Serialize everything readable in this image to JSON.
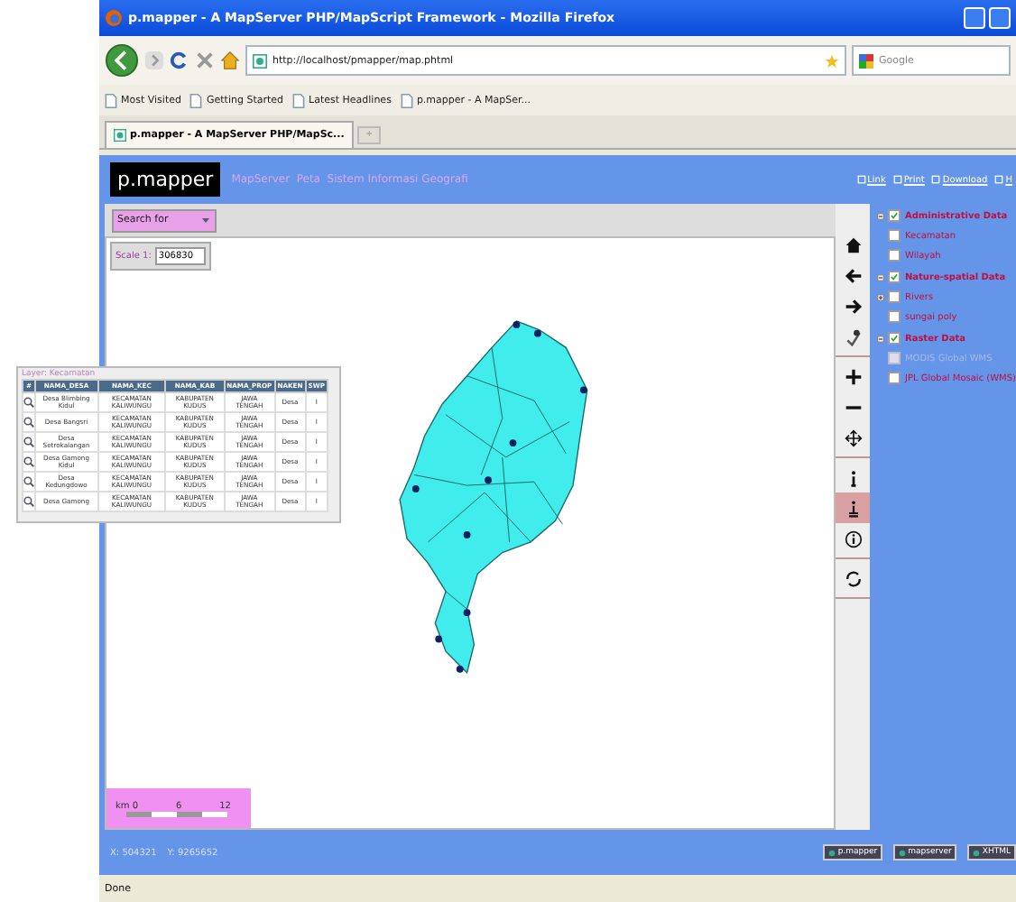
{
  "window": {
    "title": "p.mapper - A MapServer PHP/MapScript Framework - Mozilla Firefox"
  },
  "navigation": {
    "url": "http://localhost/pmapper/map.phtml",
    "search_placeholder": "Google"
  },
  "bookmarks": [
    "Most Visited",
    "Getting Started",
    "Latest Headlines",
    "p.mapper - A MapSer..."
  ],
  "tabs": [
    {
      "label": "p.mapper - A MapServer PHP/MapSc...",
      "selected": true
    }
  ],
  "new_tab": "+",
  "page": {
    "logo": "p.mapper",
    "heading": "MapServer  Peta  Sistem Informasi Geografi",
    "links": [
      "Link",
      "Print",
      "Download",
      "H"
    ],
    "search": {
      "value": "Search for"
    },
    "scale": {
      "label": "Scale 1:",
      "value": "306830"
    },
    "scale_bar": {
      "unit": "km 0",
      "ticks": [
        "6",
        "12"
      ]
    },
    "toolbar": [
      {
        "tools": [
          {
            "kind": "home",
            "selected": false
          },
          {
            "kind": "back",
            "selected": false
          },
          {
            "kind": "forward",
            "selected": false
          },
          {
            "kind": "select",
            "selected": false
          }
        ]
      },
      {
        "tools": [
          {
            "kind": "zoomin",
            "selected": false
          },
          {
            "kind": "zoomout",
            "selected": false
          },
          {
            "kind": "pan",
            "selected": false
          }
        ]
      },
      {
        "tools": [
          {
            "kind": "identify",
            "selected": false
          },
          {
            "kind": "query",
            "selected": true
          },
          {
            "kind": "info",
            "selected": false
          }
        ]
      },
      {
        "tools": [
          {
            "kind": "refresh",
            "selected": false
          }
        ]
      }
    ],
    "layers": [
      {
        "label": "Administrative Data",
        "checked": true,
        "children": [
          {
            "label": "Kecamatan",
            "checked": false,
            "disabled": false,
            "expandable": false
          },
          {
            "label": "Wilayah",
            "checked": false,
            "disabled": false,
            "expandable": false
          }
        ]
      },
      {
        "label": "Nature-spatial Data",
        "checked": true,
        "children": [
          {
            "label": "Rivers",
            "checked": false,
            "disabled": false,
            "expandable": true
          },
          {
            "label": "sungai poly",
            "checked": false,
            "disabled": false,
            "expandable": false
          }
        ]
      },
      {
        "label": "Raster Data",
        "checked": true,
        "children": [
          {
            "label": "MODIS Global WMS",
            "checked": false,
            "disabled": true,
            "expandable": false
          },
          {
            "label": "JPL Global Mosaic (WMS)",
            "checked": false,
            "disabled": false,
            "expandable": false
          }
        ]
      }
    ],
    "coordinates": {
      "x": "X: 504321",
      "y": "Y: 9265652"
    },
    "badges": [
      "p.mapper",
      "mapserver",
      "XHTML"
    ]
  },
  "result_table": {
    "title": "Layer: Kecamatan",
    "columns": [
      "#",
      "NAMA_DESA",
      "NAMA_KEC",
      "NAMA_KAB",
      "NAMA_PROP",
      "NAKEN",
      "SWP"
    ],
    "rows": [
      [
        "",
        "Desa Blimbing Kidul",
        "KECAMATAN KALIWUNGU",
        "KABUPATEN KUDUS",
        "JAWA TENGAH",
        "Desa",
        "I"
      ],
      [
        "",
        "Desa Bangsri",
        "KECAMATAN KALIWUNGU",
        "KABUPATEN KUDUS",
        "JAWA TENGAH",
        "Desa",
        "I"
      ],
      [
        "",
        "Desa Setrokalangan",
        "KECAMATAN KALIWUNGU",
        "KABUPATEN KUDUS",
        "JAWA TENGAH",
        "Desa",
        "I"
      ],
      [
        "",
        "Desa Gamong Kidul",
        "KECAMATAN KALIWUNGU",
        "KABUPATEN KUDUS",
        "JAWA TENGAH",
        "Desa",
        "I"
      ],
      [
        "",
        "Desa Kedungdowo",
        "KECAMATAN KALIWUNGU",
        "KABUPATEN KUDUS",
        "JAWA TENGAH",
        "Desa",
        "I"
      ],
      [
        "",
        "Desa Gamong",
        "KECAMATAN KALIWUNGU",
        "KABUPATEN KUDUS",
        "JAWA TENGAH",
        "Desa",
        "I"
      ]
    ]
  },
  "status_bar": "Done"
}
